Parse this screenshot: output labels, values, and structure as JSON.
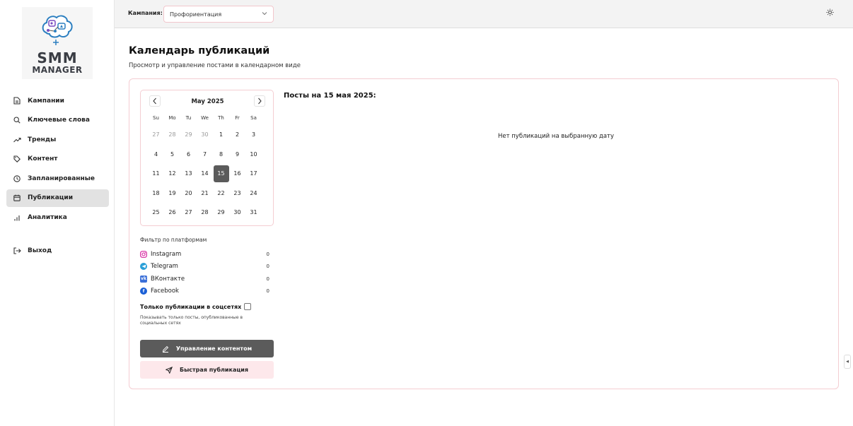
{
  "logo": {
    "line1": "SMM",
    "line2": "MANAGER"
  },
  "sidebar": {
    "items": [
      {
        "label": "Кампании",
        "icon": "document-icon"
      },
      {
        "label": "Ключевые слова",
        "icon": "search-icon"
      },
      {
        "label": "Тренды",
        "icon": "trending-icon"
      },
      {
        "label": "Контент",
        "icon": "tag-icon"
      },
      {
        "label": "Запланированные",
        "icon": "clock-icon"
      },
      {
        "label": "Публикации",
        "icon": "calendar-icon",
        "active": true
      },
      {
        "label": "Аналитика",
        "icon": "bar-chart-icon"
      }
    ],
    "logout": "Выход"
  },
  "topbar": {
    "campaign_label": "Кампания:",
    "campaign_value": "Профориентация",
    "theme_icon": "sun-icon"
  },
  "page": {
    "title": "Календарь публикаций",
    "subtitle": "Просмотр и управление постами в календарном виде"
  },
  "calendar": {
    "month": "May 2025",
    "weekdays": [
      "Su",
      "Mo",
      "Tu",
      "We",
      "Th",
      "Fr",
      "Sa"
    ],
    "days": [
      {
        "d": "27",
        "out": true
      },
      {
        "d": "28",
        "out": true
      },
      {
        "d": "29",
        "out": true
      },
      {
        "d": "30",
        "out": true
      },
      {
        "d": "1"
      },
      {
        "d": "2"
      },
      {
        "d": "3"
      },
      {
        "d": "4"
      },
      {
        "d": "5"
      },
      {
        "d": "6"
      },
      {
        "d": "7"
      },
      {
        "d": "8"
      },
      {
        "d": "9"
      },
      {
        "d": "10"
      },
      {
        "d": "11"
      },
      {
        "d": "12"
      },
      {
        "d": "13"
      },
      {
        "d": "14"
      },
      {
        "d": "15",
        "selected": true
      },
      {
        "d": "16"
      },
      {
        "d": "17"
      },
      {
        "d": "18"
      },
      {
        "d": "19"
      },
      {
        "d": "20"
      },
      {
        "d": "21"
      },
      {
        "d": "22"
      },
      {
        "d": "23"
      },
      {
        "d": "24"
      },
      {
        "d": "25"
      },
      {
        "d": "26"
      },
      {
        "d": "27"
      },
      {
        "d": "28"
      },
      {
        "d": "29"
      },
      {
        "d": "30"
      },
      {
        "d": "31"
      }
    ]
  },
  "filter": {
    "title": "Фильтр по платформам",
    "platforms": [
      {
        "name": "Instagram",
        "count": "0",
        "icon": "instagram-icon",
        "color": "#d6249f"
      },
      {
        "name": "Telegram",
        "count": "0",
        "icon": "telegram-icon",
        "color": "#2a9fd8"
      },
      {
        "name": "ВКонтакте",
        "count": "0",
        "icon": "vk-icon",
        "color": "#3b6fd8"
      },
      {
        "name": "Facebook",
        "count": "0",
        "icon": "facebook-icon",
        "color": "#1a5fd6"
      }
    ],
    "only_social_label": "Только публикации в соцсетях",
    "only_social_hint": "Показывать только посты, опубликованные в социальных сетях"
  },
  "buttons": {
    "manage": "Управление контентом",
    "quick": "Быстрая публикация"
  },
  "posts": {
    "title": "Посты на 15 мая 2025:",
    "empty": "Нет публикаций на выбранную дату"
  },
  "colors": {
    "accent_border": "#f4cdd2",
    "dark_button": "#5b5b5b",
    "light_button": "#fde8eb"
  }
}
